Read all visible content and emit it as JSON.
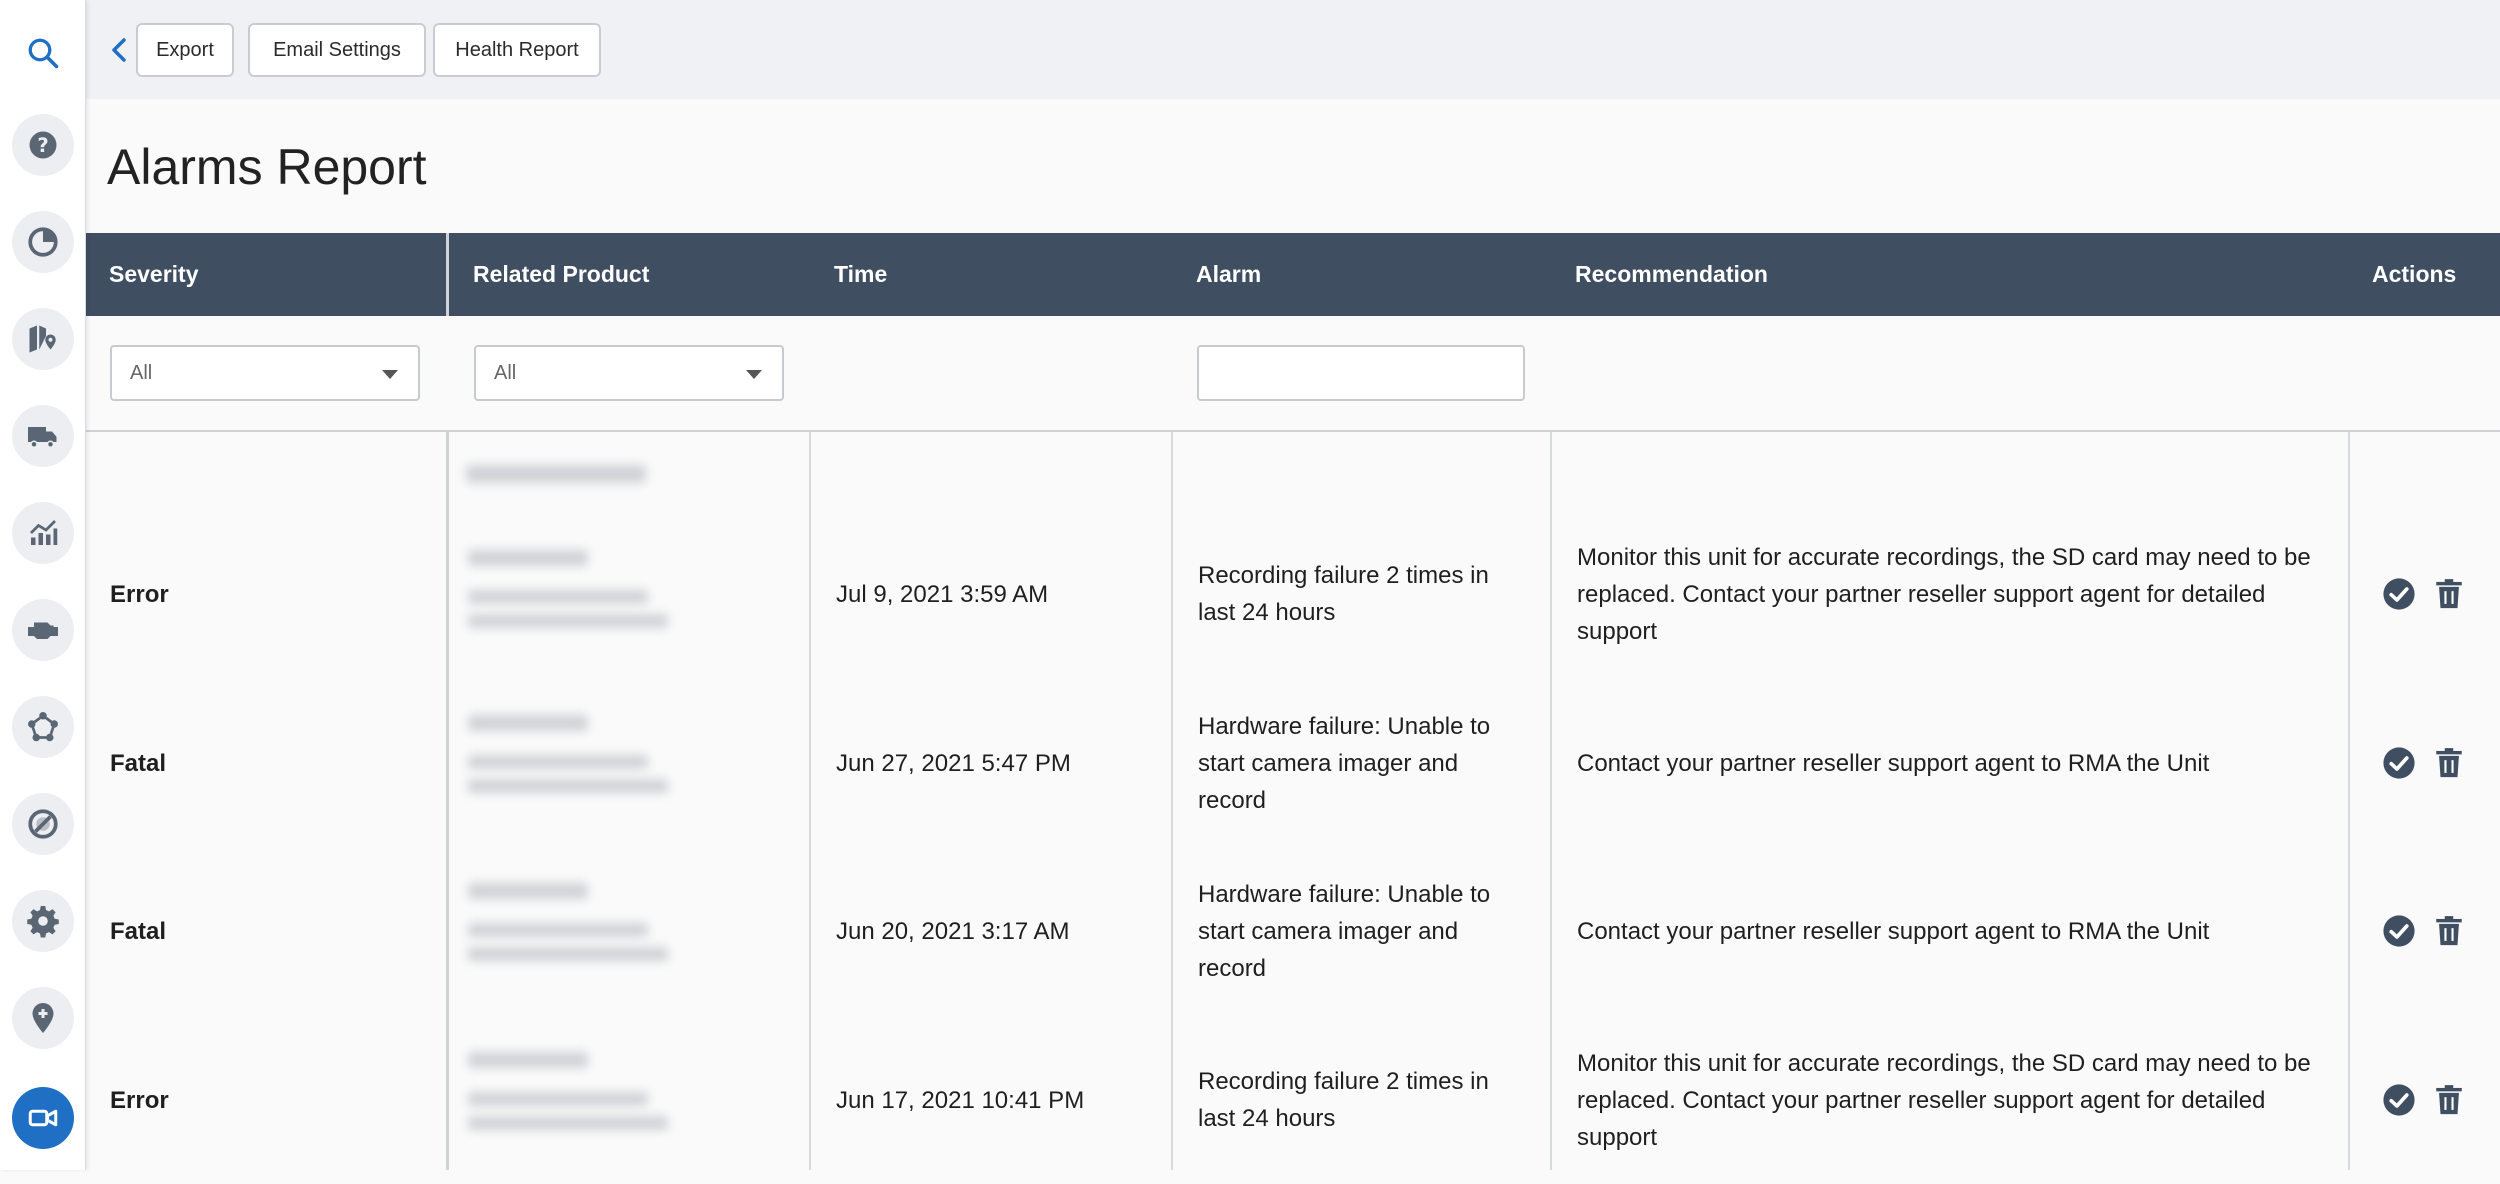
{
  "sidebar": {
    "items": [
      {
        "name": "search-icon"
      },
      {
        "name": "help-icon"
      },
      {
        "name": "pie-chart-icon"
      },
      {
        "name": "map-pin-icon"
      },
      {
        "name": "truck-icon"
      },
      {
        "name": "analytics-chart-icon"
      },
      {
        "name": "engine-icon"
      },
      {
        "name": "network-icon"
      },
      {
        "name": "blocked-icon"
      },
      {
        "name": "gear-icon"
      },
      {
        "name": "location-add-icon"
      },
      {
        "name": "video-camera-icon",
        "active": true
      }
    ],
    "accent": "#1f6fc5"
  },
  "toolbar": {
    "export_label": "Export",
    "email_settings_label": "Email Settings",
    "health_report_label": "Health Report"
  },
  "page": {
    "title": "Alarms Report"
  },
  "table": {
    "header_color": "#404e61",
    "columns": [
      "Severity",
      "Related Product",
      "Time",
      "Alarm",
      "Recommendation",
      "Actions"
    ],
    "filters": {
      "severity": "All",
      "related_product": "All",
      "alarm_search": ""
    },
    "rows": [
      {
        "severity": "Error",
        "time": "Jul 9, 2021 3:59 AM",
        "alarm": "Recording failure 2 times in last 24 hours",
        "recommendation": "Monitor this unit for accurate recordings, the SD card may need to be replaced. Contact your partner reseller support agent for detailed support"
      },
      {
        "severity": "Fatal",
        "time": "Jun 27, 2021 5:47 PM",
        "alarm": "Hardware failure: Unable to start camera imager and record",
        "recommendation": "Contact your partner reseller support agent to RMA the Unit"
      },
      {
        "severity": "Fatal",
        "time": "Jun 20, 2021 3:17 AM",
        "alarm": "Hardware failure: Unable to start camera imager and record",
        "recommendation": "Contact your partner reseller support agent to RMA the Unit"
      },
      {
        "severity": "Error",
        "time": "Jun 17, 2021 10:41 PM",
        "alarm": "Recording failure 2 times in last 24 hours",
        "recommendation": "Monitor this unit for accurate recordings, the SD card may need to be replaced. Contact your partner reseller support agent for detailed support"
      }
    ],
    "row_actions": [
      "check-circle-icon",
      "trash-icon"
    ]
  }
}
